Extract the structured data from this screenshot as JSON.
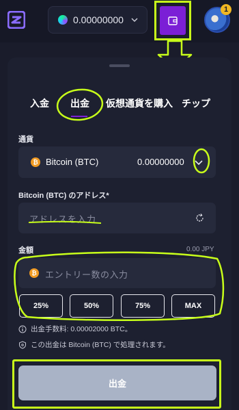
{
  "header": {
    "balance_value": "0.00000000",
    "notification_count": "1"
  },
  "tabs": [
    {
      "label": "入金"
    },
    {
      "label": "出金"
    },
    {
      "label": "仮想通貨を購入"
    },
    {
      "label": "チップ"
    }
  ],
  "active_tab": "出金",
  "currency": {
    "label": "通貨",
    "selected": "Bitcoin (BTC)",
    "amount": "0.00000000"
  },
  "address": {
    "label": "Bitcoin (BTC) のアドレス*",
    "placeholder": "アドレスを入力"
  },
  "amount": {
    "label": "金額",
    "fiat_value": "0.00 JPY",
    "placeholder": "エントリー数の入力"
  },
  "percent_buttons": [
    "25%",
    "50%",
    "75%",
    "MAX"
  ],
  "info": {
    "fee_text": "出金手数料: 0.00002000 BTC。",
    "process_text": "この出金は Bitcoin (BTC) で処理されます。"
  },
  "submit_label": "出金",
  "colors": {
    "accent_purple": "#7b1fd6",
    "annotation_yellow": "#c8ff1a",
    "btc_orange": "#f09a22",
    "panel_bg": "#1d2030"
  },
  "icons": [
    "app-logo-icon",
    "chevron-down-icon",
    "wallet-icon",
    "bitcoin-icon",
    "refresh-icon",
    "info-icon",
    "shield-icon"
  ]
}
